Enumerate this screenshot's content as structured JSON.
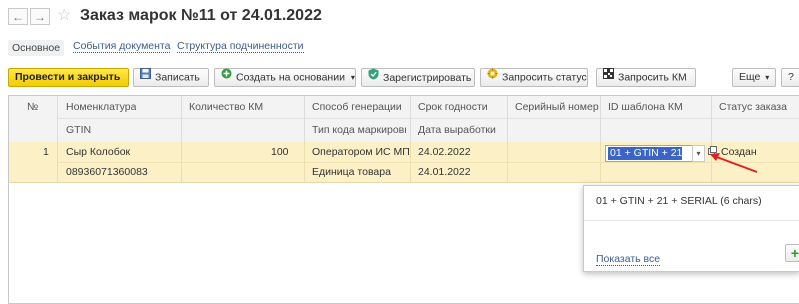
{
  "window": {
    "title": "Заказ марок №11 от 24.01.2022",
    "back_glyph": "←",
    "forward_glyph": "→",
    "favorite_glyph": "☆"
  },
  "tabs": [
    {
      "label": "Основное"
    },
    {
      "label": "События документа"
    },
    {
      "label": "Структура подчиненности"
    }
  ],
  "toolbar": {
    "post_close": "Провести и закрыть",
    "save": "Записать",
    "create_based": "Создать на основании",
    "register": "Зарегистрировать",
    "request_status": "Запросить статус",
    "request_km": "Запросить КМ",
    "more": "Еще",
    "help": "?",
    "dropdown_glyph": "▾"
  },
  "table": {
    "columns": [
      {
        "top": "№",
        "bottom": ""
      },
      {
        "top": "Номенклатура",
        "bottom": "GTIN"
      },
      {
        "top": "Количество КМ",
        "bottom": ""
      },
      {
        "top": "Способ генерации ...",
        "bottom": "Тип кода маркировки"
      },
      {
        "top": "Срок годности",
        "bottom": "Дата выработки"
      },
      {
        "top": "Серийный номер",
        "bottom": ""
      },
      {
        "top": "ID шаблона КМ",
        "bottom": ""
      },
      {
        "top": "Статус заказа",
        "bottom": ""
      }
    ],
    "rows": [
      {
        "num": "1",
        "nomenclature": "Сыр Колобок",
        "gtin": "08936071360083",
        "quantity": "100",
        "generation_method": "Оператором ИС МП",
        "code_type": "Единица товара",
        "expiry_date": "24.02.2022",
        "production_date": "24.01.2022",
        "serial": "",
        "template_id": "01 + GTIN + 21 +",
        "status": "Создан"
      }
    ]
  },
  "dropdown": {
    "option": "01 + GTIN + 21 + SERIAL (6 chars)",
    "show_all": "Показать все",
    "add_glyph": "+"
  },
  "colors": {
    "primary_button": "#f3cb05",
    "selected_row": "#fbf0c6",
    "selection": "#3b64c7",
    "link": "#3c5c8a",
    "arrow": "#e02020"
  }
}
